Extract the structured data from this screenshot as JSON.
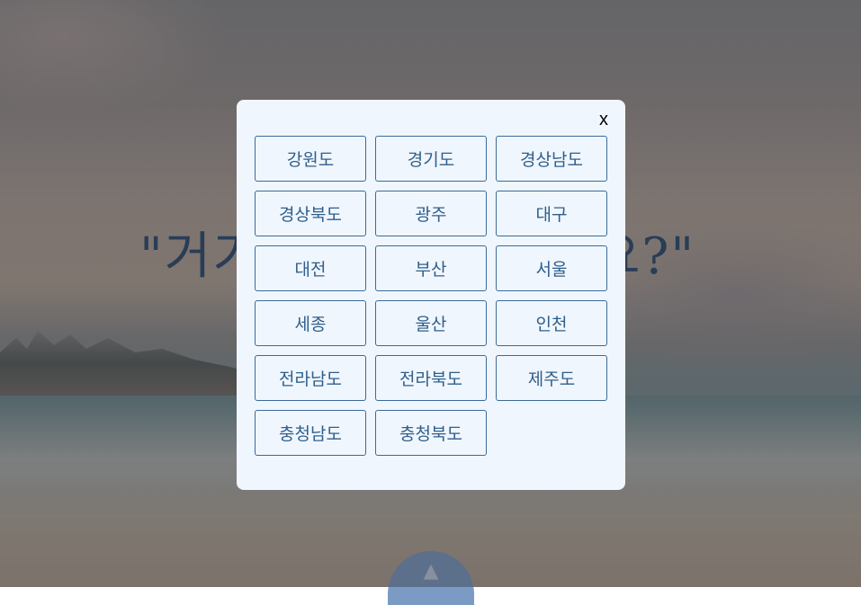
{
  "background": {
    "headline_left": "\"거기",
    "headline_right": "요?\""
  },
  "modal": {
    "close_label": "x",
    "regions": [
      "강원도",
      "경기도",
      "경상남도",
      "경상북도",
      "광주",
      "대구",
      "대전",
      "부산",
      "서울",
      "세종",
      "울산",
      "인천",
      "전라남도",
      "전라북도",
      "제주도",
      "충청남도",
      "충청북도"
    ]
  },
  "scroll_top": {
    "icon": "▲"
  },
  "colors": {
    "modal_bg": "#f0f6fd",
    "button_border": "#3a6b96",
    "button_text": "#2f5f8c",
    "headline": "#1e3f63",
    "scroll_button": "#7b9bc4"
  }
}
